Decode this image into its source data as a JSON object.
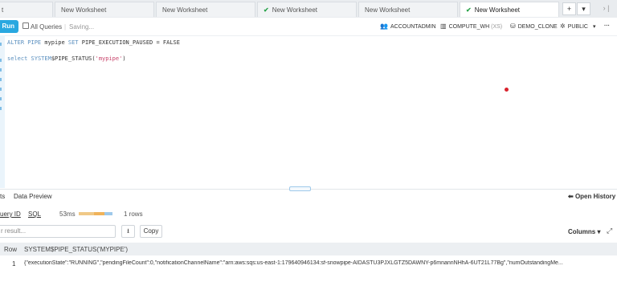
{
  "tabs": [
    {
      "label": "t",
      "checked": false
    },
    {
      "label": "New Worksheet",
      "checked": false
    },
    {
      "label": "New Worksheet",
      "checked": false
    },
    {
      "label": "New Worksheet",
      "checked": true
    },
    {
      "label": "New Worksheet",
      "checked": false
    },
    {
      "label": "New Worksheet",
      "checked": true
    }
  ],
  "tab_controls": {
    "add": "+",
    "dropdown": "▾",
    "nav": "› |"
  },
  "toolbar": {
    "run_label": "Run",
    "all_queries_label": "All Queries",
    "saving_label": "Saving...",
    "role": "ACCOUNTADMIN",
    "warehouse": "COMPUTE_WH",
    "warehouse_size": "(XS)",
    "database": "DEMO_CLONE",
    "schema": "PUBLIC",
    "schema_caret": "▾",
    "more": "···"
  },
  "editor": {
    "line1": {
      "kw1": "ALTER PIPE",
      "t1": " mypipe ",
      "kw2": "SET",
      "t2": " PIPE_EXECUTION_PAUSED = FALSE"
    },
    "line2": {
      "kw1": "select",
      "t1": " ",
      "kw2": "SYSTEM",
      "t2": "$PIPE_STATUS(",
      "str": "'mypipe'",
      "t3": ")"
    }
  },
  "results": {
    "tab_results": "ts",
    "tab_preview": "Data Preview",
    "open_history": "Open History",
    "query_id_label": "uery ID",
    "sql_label": "SQL",
    "duration": "53ms",
    "row_count": "1 rows",
    "filter_placeholder": "r result...",
    "download_icon": "⭳",
    "copy_label": "Copy",
    "columns_label": "Columns",
    "columns_caret": "▾",
    "expand_icon": "⤢",
    "duration_bar": {
      "colors": [
        "#f0c987",
        "#f0b35a",
        "#9ec9ea"
      ],
      "fractions": [
        0.45,
        0.32,
        0.23
      ]
    }
  },
  "table": {
    "headers": [
      "Row",
      "SYSTEM$PIPE_STATUS('MYPIPE')"
    ],
    "rows": [
      {
        "row": "1",
        "value": "{\"executionState\":\"RUNNING\",\"pendingFileCount\":0,\"notificationChannelName\":\"arn:aws:sqs:us-east-1:179640946134:sf-snowpipe-AIDASTU3PJXLGTZ5DAWNY-p6mnannNHhA-6UT21L77Bg\",\"numOutstandingMe..."
      }
    ]
  }
}
